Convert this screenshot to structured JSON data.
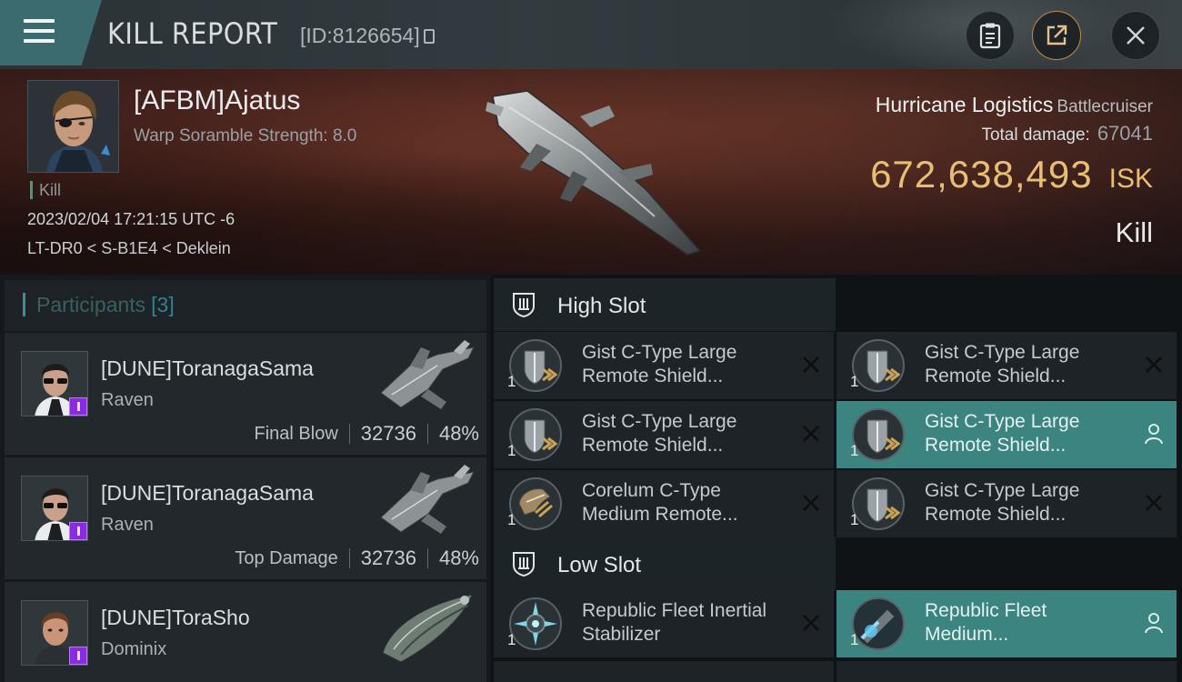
{
  "header": {
    "title": "KILL REPORT",
    "report_id": "[ID:8126654]",
    "buttons": [
      "clipboard",
      "share",
      "close"
    ]
  },
  "victim": {
    "name": "[AFBM]Ajatus",
    "scramble": "Warp Soramble Strength: 8.0",
    "kill_tag": "Kill",
    "datetime": "2023/02/04 17:21:15 UTC -6",
    "location": "LT-DR0 < S-B1E4 < Deklein",
    "ship_name": "Hurricane Logistics",
    "ship_class": "Battlecruiser",
    "damage_label": "Total damage:",
    "damage_value": "67041",
    "isk_amount": "672,638,493",
    "isk_currency": "ISK",
    "result": "Kill"
  },
  "participants": {
    "label": "Participants",
    "count": "[3]",
    "rows": [
      {
        "name": "[DUNE]ToranagaSama",
        "ship": "Raven",
        "role": "Final Blow",
        "damage": "32736",
        "percent": "48%"
      },
      {
        "name": "[DUNE]ToranagaSama",
        "ship": "Raven",
        "role": "Top Damage",
        "damage": "32736",
        "percent": "48%"
      },
      {
        "name": "[DUNE]ToraSho",
        "ship": "Dominix",
        "role": "",
        "damage": "",
        "percent": ""
      }
    ]
  },
  "slots": {
    "high": {
      "label": "High Slot",
      "items": [
        {
          "qty": "1",
          "line1": "Gist C-Type Large",
          "line2": "Remote Shield...",
          "state": "destroyed"
        },
        {
          "qty": "1",
          "line1": "Gist C-Type Large",
          "line2": "Remote Shield...",
          "state": "destroyed"
        },
        {
          "qty": "1",
          "line1": "Gist C-Type Large",
          "line2": "Remote Shield...",
          "state": "destroyed"
        },
        {
          "qty": "1",
          "line1": "Gist C-Type Large",
          "line2": "Remote Shield...",
          "state": "dropped"
        },
        {
          "qty": "1",
          "line1": "Corelum C-Type",
          "line2": "Medium Remote...",
          "state": "destroyed"
        },
        {
          "qty": "1",
          "line1": "Gist C-Type Large",
          "line2": "Remote Shield...",
          "state": "destroyed"
        }
      ]
    },
    "low": {
      "label": "Low Slot",
      "items": [
        {
          "qty": "1",
          "line1": "Republic Fleet Inertial",
          "line2": "Stabilizer",
          "state": "destroyed"
        },
        {
          "qty": "1",
          "line1": "Republic Fleet",
          "line2": "Medium...",
          "state": "dropped"
        }
      ]
    }
  },
  "colors": {
    "accent_teal": "#3c8480",
    "isk_gold": "#e8be73",
    "badge_purple": "#8a2be2"
  }
}
